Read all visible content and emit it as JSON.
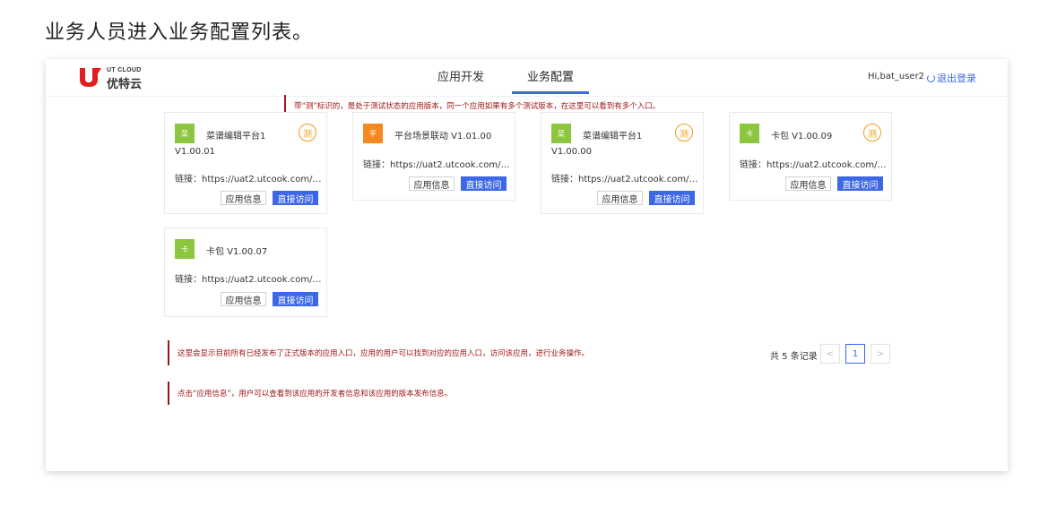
{
  "page_heading": "业务人员进入业务配置列表。",
  "header": {
    "logo_en": "UT CLOUD",
    "logo_cn": "优特云",
    "tabs": [
      {
        "label": "应用开发",
        "active": false
      },
      {
        "label": "业务配置",
        "active": true
      }
    ],
    "user": "Hi,bat_user2",
    "logout": "退出登录"
  },
  "annotations": {
    "test_note": "带“测”标识的，是处于测试状态的应用版本，同一个应用如果有多个测试版本，在这里可以看到有多个入口。",
    "list_note": "这里会显示目前所有已经发布了正式版本的应用入口，应用的用户可以找到对应的应用入口，访问该应用，进行业务操作。",
    "info_note": "点击“应用信息”，用户可以查看到该应用的开发者信息和该应用的版本发布信息。"
  },
  "cards": [
    {
      "icon_char": "菜",
      "icon_color": "#8cc63f",
      "title": "菜谱编辑平台1",
      "version": "V1.00.01",
      "link_label": "链接：",
      "link": "https://uat2.utcook.com/act...",
      "test_badge": "测"
    },
    {
      "icon_char": "平",
      "icon_color": "#f5891f",
      "title": "平台场景联动 V1.01.00",
      "version": "",
      "link_label": "链接：",
      "link": "https://uat2.utcook.com/act...",
      "test_badge": ""
    },
    {
      "icon_char": "菜",
      "icon_color": "#8cc63f",
      "title": "菜谱编辑平台1",
      "version": "V1.00.00",
      "link_label": "链接：",
      "link": "https://uat2.utcook.com/act...",
      "test_badge": "测"
    },
    {
      "icon_char": "卡",
      "icon_color": "#8cc63f",
      "title": "卡包 V1.00.09",
      "version": "",
      "link_label": "链接：",
      "link": "https://uat2.utcook.com/act...",
      "test_badge": "测"
    },
    {
      "icon_char": "卡",
      "icon_color": "#8cc63f",
      "title": "卡包 V1.00.07",
      "version": "",
      "link_label": "链接：",
      "link": "https://uat2.utcook.com/act...",
      "test_badge": ""
    }
  ],
  "card_buttons": {
    "info": "应用信息",
    "visit": "直接访问"
  },
  "pagination": {
    "total": "共 5 条记录",
    "prev": "<",
    "current": "1",
    "next": ">"
  },
  "colors": {
    "accent": "#3c67e6",
    "annotation": "#a31515",
    "test_badge": "#f39c1e"
  }
}
